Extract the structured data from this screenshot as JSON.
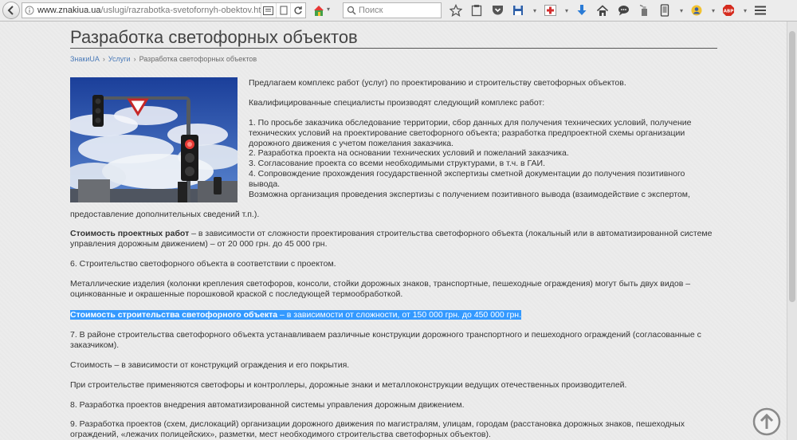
{
  "browser": {
    "url_domain": "www.znakiua.ua",
    "url_path": "/uslugi/razrabotka-svetofornyh-obektov.htr",
    "search_placeholder": "Поиск",
    "abp_label": "ABP"
  },
  "page": {
    "title": "Разработка светофорных объектов",
    "breadcrumb": {
      "home": "ЗнакиUA",
      "services": "Услуги",
      "current": "Разработка светофорных объектов",
      "separator": "›"
    },
    "intro": "Предлагаем комплекс работ (услуг) по проектированию и строительству светофорных объектов.",
    "qualified": "Квалифицированные специалисты производят следующий комплекс работ:",
    "list": [
      "1. По просьбе заказчика обследование территории, сбор данных для получения технических условий, получение",
      "технических условий на проектирование светофорного объекта; разработка предпроектной схемы организации",
      "дорожного движения с учетом пожелания заказчика.",
      "2. Разработка проекта на основании технических условий и пожеланий заказчика.",
      "3. Согласование проекта со всеми необходимыми структурами, в т.ч. в ГАИ.",
      "4. Сопровождение прохождения государственной экспертизы сметной документации до получения позитивного",
      "вывода.",
      "Возможна организация проведения экспертизы с получением позитивного вывода (взаимодействие с экспертом,"
    ],
    "expertise_cont": "предоставление дополнительных сведений т.п.).",
    "cost_design_bold": "Стоимость проектных работ",
    "cost_design_line1": " – в зависимости от сложности проектирования строительства светофорного объекта (локальный или в автоматизированной системе",
    "cost_design_line2": "управления дорожным движением) – от 20 000 грн. до 45 000 грн.",
    "item6": "6. Строительство светофорного объекта в соответствии с проектом.",
    "metal_line1": "Металлические изделия (колонки крепления светофоров, консоли, стойки дорожных знаков, транспортные, пешеходные ограждения) могут быть двух видов –",
    "metal_line2": "оцинкованные и окрашенные порошковой краской с последующей термообработкой.",
    "cost_build_bold": "Стоимость строительства светофорного объекта",
    "cost_build_rest": " – в зависимости от сложности, от 150 000 грн. до 450 000 грн.",
    "item7_line1": "7. В районе строительства светофорного объекта устанавливаем различные конструкции дорожного транспортного и пешеходного ограждений (согласованные с",
    "item7_line2": "заказчиком).",
    "cost_fence": "Стоимость – в зависимости от конструкций ограждения и его покрытия.",
    "construction": "При строительстве применяются светофоры и контроллеры, дорожные знаки и металлоконструкции ведущих отечественных производителей.",
    "item8": "8. Разработка проектов внедрения автоматизированной системы управления дорожным движением.",
    "item9_line1": "9. Разработка проектов (схем, дислокаций) организации дорожного движения по магистралям, улицам, городам (расстановка дорожных знаков, пешеходных",
    "item9_line2": "ограждений, «лежачих полицейских», разметки, мест необходимого строительства светофорных объектов)."
  },
  "colors": {
    "link": "#4a7ab8",
    "selection": "#3399ff",
    "text": "#333333"
  }
}
